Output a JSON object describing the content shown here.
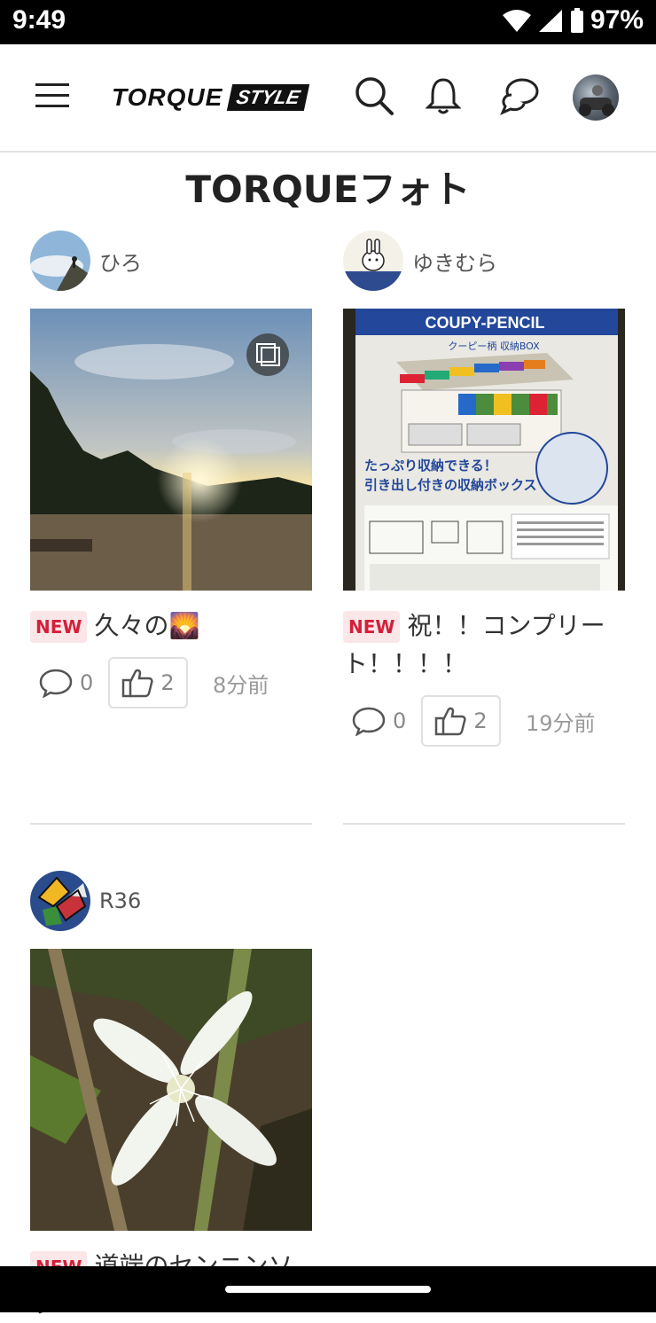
{
  "status": {
    "time": "9:49",
    "battery": "97%"
  },
  "header": {
    "logo_main": "TORQUE",
    "logo_sub": "STYLE",
    "page_title": "TORQUEフォト"
  },
  "posts": [
    {
      "user": "ひろ",
      "badge": "NEW",
      "title": "久々の🌄",
      "comments": "0",
      "likes": "2",
      "time": "8分前"
    },
    {
      "user": "ゆきむら",
      "badge": "NEW",
      "title": "祝！！コンプリート！！！！",
      "comments": "0",
      "likes": "2",
      "time": "19分前",
      "photo_text": {
        "brand": "COUPY-PENCIL",
        "sub": "クーピー柄 収納BOX",
        "caption1": "たっぷり収納できる！",
        "caption2": "引き出し付きの収納ボックス"
      }
    },
    {
      "user": "R36",
      "badge": "NEW",
      "title": "道端のセンニンソウ"
    }
  ],
  "colors": {
    "accent_red": "#d3203b",
    "badge_bg": "#fbe6e8"
  }
}
